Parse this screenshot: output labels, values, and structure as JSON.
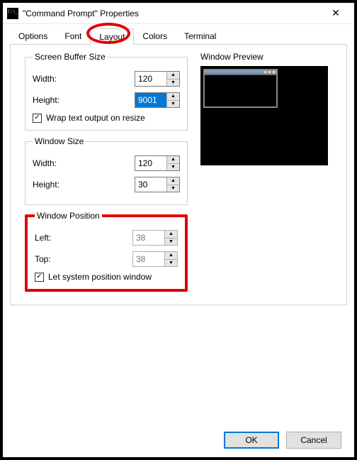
{
  "window": {
    "title": "\"Command Prompt\" Properties"
  },
  "tabs": {
    "options": "Options",
    "font": "Font",
    "layout": "Layout",
    "colors": "Colors",
    "terminal": "Terminal"
  },
  "buffer": {
    "legend": "Screen Buffer Size",
    "width_label": "Width:",
    "width_value": "120",
    "height_label": "Height:",
    "height_value": "9001",
    "wrap_label": "Wrap text output on resize",
    "wrap_checked": true
  },
  "windowSize": {
    "legend": "Window Size",
    "width_label": "Width:",
    "width_value": "120",
    "height_label": "Height:",
    "height_value": "30"
  },
  "windowPos": {
    "legend": "Window Position",
    "left_label": "Left:",
    "left_value": "38",
    "top_label": "Top:",
    "top_value": "38",
    "system_label": "Let system position window",
    "system_checked": true
  },
  "preview": {
    "label": "Window Preview"
  },
  "buttons": {
    "ok": "OK",
    "cancel": "Cancel"
  }
}
